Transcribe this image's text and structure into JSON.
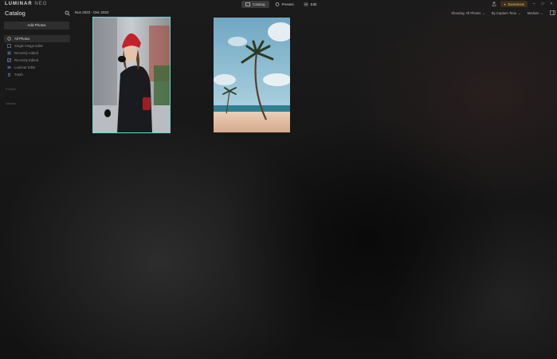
{
  "app": {
    "logo_main": "LUMINAR",
    "logo_sub": "NEO"
  },
  "mode_tabs": [
    {
      "label": "Catalog",
      "icon": "catalog-icon",
      "active": true
    },
    {
      "label": "Presets",
      "icon": "presets-icon",
      "active": false
    },
    {
      "label": "Edit",
      "icon": "edit-icon",
      "active": false
    }
  ],
  "top_right": {
    "extensions_label": "Extensions"
  },
  "sidebar": {
    "title": "Catalog",
    "add_photos": "Add Photos",
    "items": [
      {
        "label": "All Photos",
        "icon": "photos-icon",
        "active": true
      },
      {
        "label": "Single Image Edits",
        "icon": "single-edit-icon",
        "active": false
      },
      {
        "label": "Recently Added",
        "icon": "recently-added-icon",
        "active": false
      },
      {
        "label": "Recently Edited",
        "icon": "recently-edited-icon",
        "active": false
      },
      {
        "label": "Luminar Edits",
        "icon": "luminar-edits-icon",
        "active": false
      },
      {
        "label": "Trash",
        "icon": "trash-icon",
        "active": false
      }
    ],
    "section_folders": "Folders",
    "section_albums": "Albums"
  },
  "content": {
    "date_range": "Nov 2022 - Dec 2022",
    "showing": "Showing: All Photos",
    "sort": "By Capture Time",
    "size": "Medium"
  },
  "photos": [
    {
      "subject": "woman-red-beanie",
      "selected": true
    },
    {
      "subject": "palm-tree-beach",
      "selected": false
    }
  ],
  "colors": {
    "accent": "#6fd3d0",
    "extensions": "#e8c07a"
  }
}
